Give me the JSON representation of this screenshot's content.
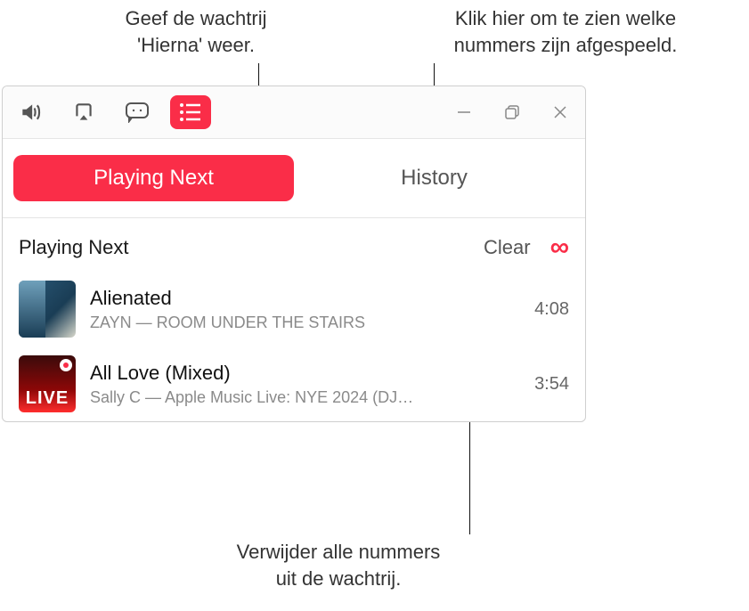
{
  "callouts": {
    "top_left": "Geef de wachtrij\n'Hierna' weer.",
    "top_right": "Klik hier om te zien welke\nnummers zijn afgespeeld.",
    "bottom": "Verwijder alle nummers\nuit de wachtrij."
  },
  "tabs": {
    "playing_next": "Playing Next",
    "history": "History"
  },
  "queue": {
    "header_label": "Playing Next",
    "clear_label": "Clear",
    "autoplay_glyph": "∞"
  },
  "tracks": [
    {
      "title": "Alienated",
      "subtitle": "ZAYN — ROOM UNDER THE STAIRS",
      "duration": "4:08",
      "art_live_text": ""
    },
    {
      "title": "All Love (Mixed)",
      "subtitle": "Sally C — Apple Music Live: NYE 2024 (DJ…",
      "duration": "3:54",
      "art_live_text": "LIVE"
    }
  ],
  "colors": {
    "accent": "#fa2d48"
  }
}
